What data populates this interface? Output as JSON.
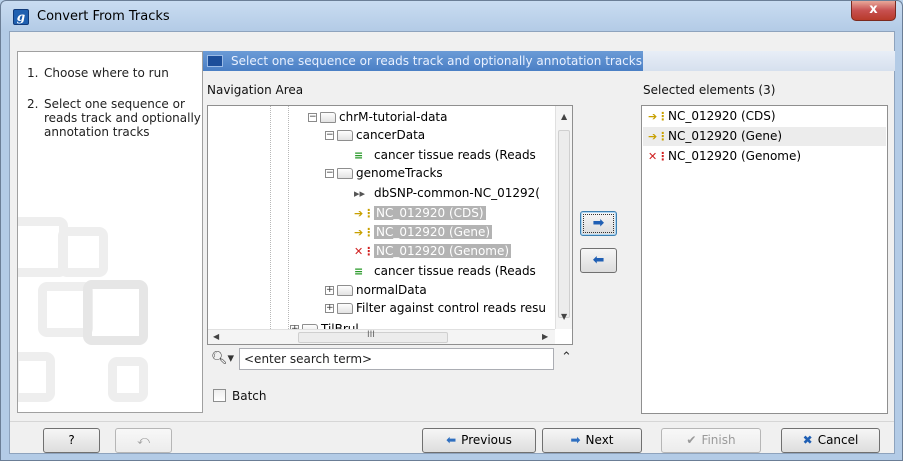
{
  "window": {
    "title": "Convert From Tracks",
    "app_icon": "g",
    "close_glyph": "x"
  },
  "steps": [
    {
      "num": "1.",
      "label": "Choose where to run"
    },
    {
      "num": "2.",
      "label": "Select one sequence or reads track and optionally annotation tracks"
    }
  ],
  "header": {
    "text": "Select one sequence or reads track and optionally annotation tracks"
  },
  "navigation": {
    "title": "Navigation Area",
    "items": [
      {
        "label": "chrM-tutorial-data",
        "type": "folder",
        "icon": "folder-open-icon"
      },
      {
        "label": "cancerData",
        "type": "folder",
        "icon": "folder-open-icon"
      },
      {
        "label": "cancer tissue reads (Reads",
        "type": "reads",
        "icon": "reads-track-icon"
      },
      {
        "label": "genomeTracks",
        "type": "folder",
        "icon": "folder-open-icon"
      },
      {
        "label": "dbSNP-common-NC_01292(",
        "type": "variant",
        "icon": "variant-track-icon"
      },
      {
        "label": "NC_012920 (CDS)",
        "type": "track",
        "icon": "annotation-track-icon",
        "selected": true
      },
      {
        "label": "NC_012920 (Gene)",
        "type": "track",
        "icon": "annotation-track-icon",
        "selected": true
      },
      {
        "label": "NC_012920 (Genome)",
        "type": "genome",
        "icon": "sequence-track-icon",
        "selected": true
      },
      {
        "label": "cancer tissue reads (Reads",
        "type": "reads",
        "icon": "reads-track-icon"
      },
      {
        "label": "normalData",
        "type": "folder",
        "icon": "folder-closed-icon"
      },
      {
        "label": "Filter against control reads resu",
        "type": "folder",
        "icon": "folder-closed-icon"
      },
      {
        "label": "TilBrul",
        "type": "folder",
        "icon": "folder-closed-icon"
      }
    ],
    "hscroll_grip": "III"
  },
  "search": {
    "placeholder": "<enter search term>",
    "icon": "search-icon"
  },
  "move_buttons": {
    "add_glyph": "➡",
    "remove_glyph": "⬅"
  },
  "selected": {
    "title": "Selected elements (3)",
    "items": [
      {
        "label": "NC_012920 (CDS)",
        "icon": "annotation-track-icon"
      },
      {
        "label": "NC_012920 (Gene)",
        "icon": "annotation-track-icon"
      },
      {
        "label": "NC_012920 (Genome)",
        "icon": "sequence-track-icon"
      }
    ]
  },
  "batch": {
    "label": "Batch",
    "checked": false
  },
  "footer": {
    "help_label": "?",
    "previous_label": "Previous",
    "next_label": "Next",
    "finish_label": "Finish",
    "cancel_label": "Cancel"
  },
  "colors": {
    "header_bar": "#4a7fc5",
    "selection": "#b3b3b3",
    "move_arrow": "#1f5fb4",
    "close_button": "#c75050"
  }
}
